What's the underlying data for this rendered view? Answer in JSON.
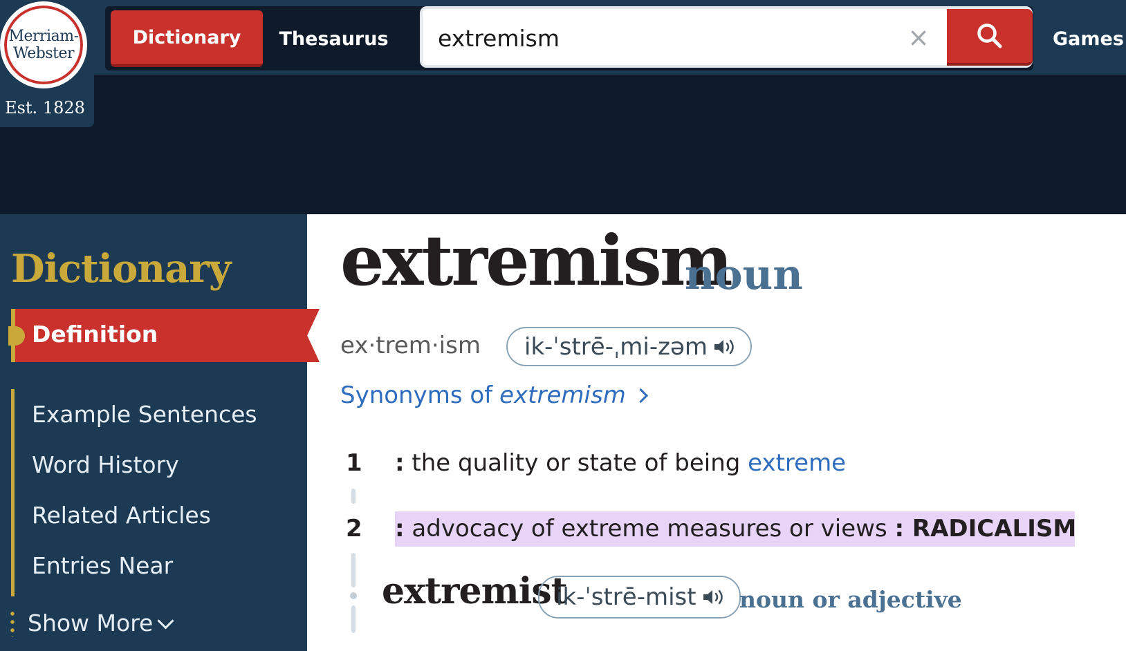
{
  "brand": {
    "logo_line1": "Merriam-",
    "logo_line2": "Webster",
    "established": "Est. 1828"
  },
  "nav": {
    "dictionary": "Dictionary",
    "thesaurus": "Thesaurus",
    "games": "Games"
  },
  "search": {
    "value": "extremism",
    "clear_symbol": "×"
  },
  "sidebar": {
    "title": "Dictionary",
    "active": "Definition",
    "items": [
      "Example Sentences",
      "Word History",
      "Related Articles",
      "Entries Near"
    ],
    "show_more": "Show More"
  },
  "entry": {
    "headword": "extremism",
    "pos": "noun",
    "syllables": "ex·trem·ism",
    "pronunciation": "ik-ˈstrē-ˌmi-zəm",
    "synonyms_prefix": "Synonyms of ",
    "synonyms_word": "extremism",
    "senses": [
      {
        "num": "1",
        "colon": ":",
        "text": " the quality or state of being ",
        "link": "extreme"
      },
      {
        "num": "2",
        "colon": ":",
        "text": " advocacy of extreme measures or views ",
        "sx_colon": ":",
        "sx": " RADICALISM"
      }
    ],
    "runon": {
      "word": "extremist",
      "pronunciation": "ik-ˈstrē-mist",
      "pos": "noun or adjective"
    }
  },
  "colors": {
    "header": "#1d3a55",
    "header_dark": "#0f1b2a",
    "accent_red": "#c8312c",
    "gold": "#c9a93a",
    "link_blue": "#2e6cbd",
    "pos_blue": "#4a7092",
    "highlight": "#e8d4f7"
  },
  "icons": {
    "search": "search-icon",
    "clear": "close-icon",
    "audio": "speaker-icon",
    "chevron_down": "chevron-down-icon",
    "chevron_right": "chevron-right-icon"
  }
}
